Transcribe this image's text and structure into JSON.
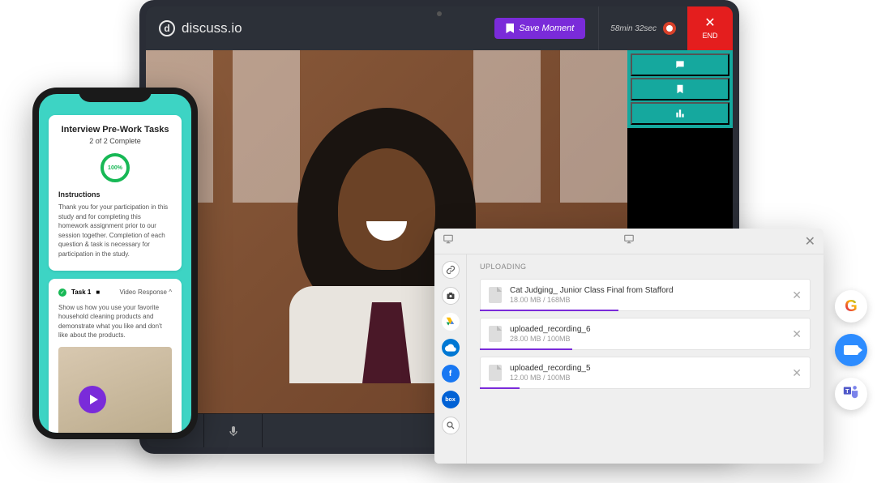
{
  "brand": {
    "name": "discuss.io"
  },
  "topbar": {
    "save_moment": "Save Moment",
    "timer": "58min 32sec",
    "end": "END"
  },
  "side_tabs": [
    "chat",
    "bookmark",
    "poll"
  ],
  "phone": {
    "title": "Interview Pre-Work Tasks",
    "progress": "2 of 2 Complete",
    "ring": "100%",
    "instructions_heading": "Instructions",
    "instructions_body": "Thank you for your participation in this study and for completing this homework assignment prior to our session together. Completion of each question & task is necessary for participation in the study.",
    "task": {
      "label": "Task 1",
      "type": "Video Response",
      "caret": "^",
      "body": "Show us how you use your favorite household cleaning products and demonstrate what you like and don't like about the products."
    }
  },
  "upload": {
    "heading": "UPLOADING",
    "files": [
      {
        "name": "Cat Judging_ Junior Class Final from Stafford",
        "size": "18.00 MB / 168MB",
        "pct": 42
      },
      {
        "name": "uploaded_recording_6",
        "size": "28.00 MB / 100MB",
        "pct": 28
      },
      {
        "name": "uploaded_recording_5",
        "size": "12.00 MB / 100MB",
        "pct": 12
      }
    ]
  },
  "integrations": [
    "google",
    "zoom",
    "teams"
  ]
}
